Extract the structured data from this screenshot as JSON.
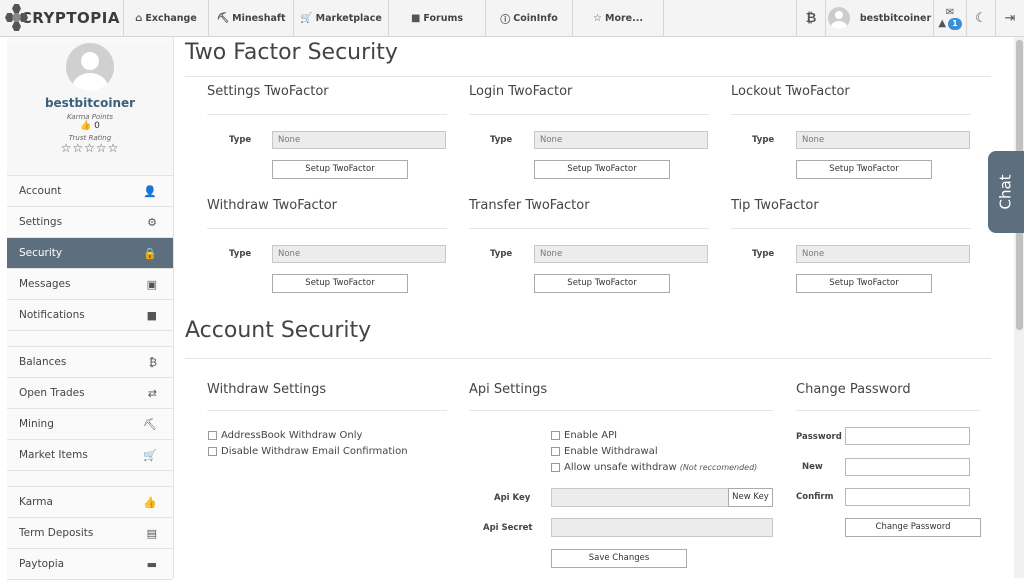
{
  "nav": {
    "logo_text": "CRYPTOPIA",
    "tabs": [
      {
        "label": "Exchange",
        "icon": "exchange-icon"
      },
      {
        "label": "Mineshaft",
        "icon": "pickaxe-icon"
      },
      {
        "label": "Marketplace",
        "icon": "cart-icon"
      },
      {
        "label": "Forums",
        "icon": "comments-icon"
      },
      {
        "label": "CoinInfo",
        "icon": "info-icon"
      },
      {
        "label": "More...",
        "icon": "star-icon"
      }
    ],
    "username": "bestbitcoiner",
    "notification_count": "1"
  },
  "sidebar": {
    "username": "bestbitcoiner",
    "karma_label": "Karma Points",
    "karma_value": "0",
    "trust_label": "Trust Rating",
    "stars": "☆☆☆☆☆",
    "items": [
      {
        "label": "Account",
        "icon": "user-icon"
      },
      {
        "label": "Settings",
        "icon": "gear-icon"
      },
      {
        "label": "Security",
        "icon": "lock-icon"
      },
      {
        "label": "Messages",
        "icon": "inbox-icon"
      },
      {
        "label": "Notifications",
        "icon": "notification-icon"
      },
      {
        "label": "Balances",
        "icon": "bitcoin-icon"
      },
      {
        "label": "Open Trades",
        "icon": "trades-icon"
      },
      {
        "label": "Mining",
        "icon": "pickaxe-icon"
      },
      {
        "label": "Market Items",
        "icon": "cart-icon"
      },
      {
        "label": "Karma",
        "icon": "thumbs-up-icon"
      },
      {
        "label": "Term Deposits",
        "icon": "deposit-icon"
      },
      {
        "label": "Paytopia",
        "icon": "card-icon"
      }
    ]
  },
  "twofactor": {
    "title": "Two Factor Security",
    "type_label": "Type",
    "button_label": "Setup TwoFactor",
    "blocks": [
      {
        "title": "Settings TwoFactor",
        "value": "None"
      },
      {
        "title": "Login TwoFactor",
        "value": "None"
      },
      {
        "title": "Lockout TwoFactor",
        "value": "None"
      },
      {
        "title": "Withdraw TwoFactor",
        "value": "None"
      },
      {
        "title": "Transfer TwoFactor",
        "value": "None"
      },
      {
        "title": "Tip TwoFactor",
        "value": "None"
      }
    ]
  },
  "account_security": {
    "title": "Account Security",
    "withdraw_settings": {
      "title": "Withdraw Settings",
      "addressbook": "AddressBook Withdraw Only",
      "disable_email": "Disable Withdraw Email Confirmation"
    },
    "api_settings": {
      "title": "Api Settings",
      "enable_api": "Enable API",
      "enable_withdrawal": "Enable Withdrawal",
      "allow_unsafe": "Allow unsafe withdraw",
      "unsafe_note": "(Not reccomended)",
      "api_key_label": "Api Key",
      "new_key_button": "New Key",
      "api_secret_label": "Api Secret",
      "save_button": "Save Changes"
    },
    "change_password": {
      "title": "Change Password",
      "password_label": "Password",
      "new_label": "New",
      "confirm_label": "Confirm",
      "button": "Change Password"
    }
  },
  "chat": {
    "label": "Chat"
  }
}
